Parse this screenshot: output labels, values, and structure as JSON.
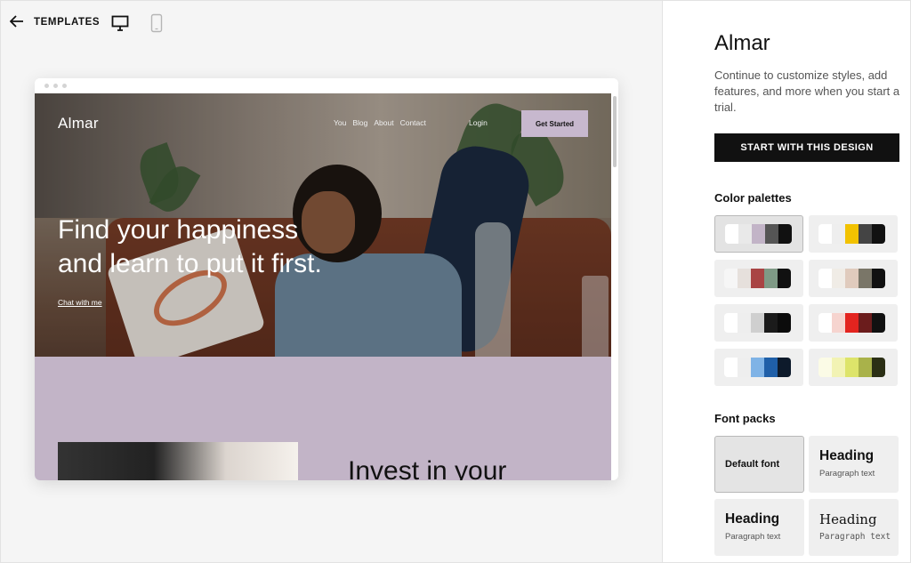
{
  "toolbar": {
    "back_icon": "arrow-left-icon",
    "templates_label": "TEMPLATES",
    "desktop_icon": "desktop-monitor-icon",
    "mobile_icon": "mobile-phone-icon"
  },
  "preview": {
    "site": {
      "logo": "Almar",
      "nav": [
        "You",
        "Blog",
        "About",
        "Contact"
      ],
      "login": "Login",
      "cta": "Get Started",
      "hero_title_line1": "Find your happiness",
      "hero_title_line2": "and learn to put it first.",
      "hero_link": "Chat with me",
      "section_title": "Invest in your"
    }
  },
  "sidebar": {
    "title": "Almar",
    "description": "Continue to customize styles, add features, and more when you start a trial.",
    "start_button": "START WITH THIS DESIGN",
    "color_palettes_heading": "Color palettes",
    "palettes": [
      {
        "selected": true,
        "colors": [
          "#ffffff",
          "#e9e9e9",
          "#c2b4c7",
          "#555555",
          "#111111"
        ]
      },
      {
        "selected": false,
        "colors": [
          "#ffffff",
          "#eeeeee",
          "#f2c200",
          "#444444",
          "#111111"
        ]
      },
      {
        "selected": false,
        "colors": [
          "#f6f6f6",
          "#e6e0dc",
          "#a94444",
          "#7f9a86",
          "#111111"
        ]
      },
      {
        "selected": false,
        "colors": [
          "#ffffff",
          "#f0ece6",
          "#e0cbbd",
          "#7a7668",
          "#111111"
        ]
      },
      {
        "selected": false,
        "colors": [
          "#ffffff",
          "#eeeeee",
          "#cfcfcf",
          "#1b1b1b",
          "#0c0c0c"
        ]
      },
      {
        "selected": false,
        "colors": [
          "#ffffff",
          "#f6d4cf",
          "#e3241f",
          "#6b1c1c",
          "#111111"
        ]
      },
      {
        "selected": false,
        "colors": [
          "#ffffff",
          "#eeeeee",
          "#7fb3e6",
          "#1f5fa8",
          "#0d1a2b"
        ]
      },
      {
        "selected": false,
        "colors": [
          "#fbfbe6",
          "#f2f3b4",
          "#dde46a",
          "#a9b24a",
          "#2b2f15"
        ]
      }
    ],
    "font_packs_heading": "Font packs",
    "font_packs": [
      {
        "selected": true,
        "default_label": "Default font"
      },
      {
        "selected": false,
        "heading": "Heading",
        "paragraph": "Paragraph text"
      },
      {
        "selected": false,
        "heading": "Heading",
        "paragraph": "Paragraph text"
      },
      {
        "selected": false,
        "heading": "Heading",
        "paragraph": "Paragraph text"
      }
    ]
  }
}
